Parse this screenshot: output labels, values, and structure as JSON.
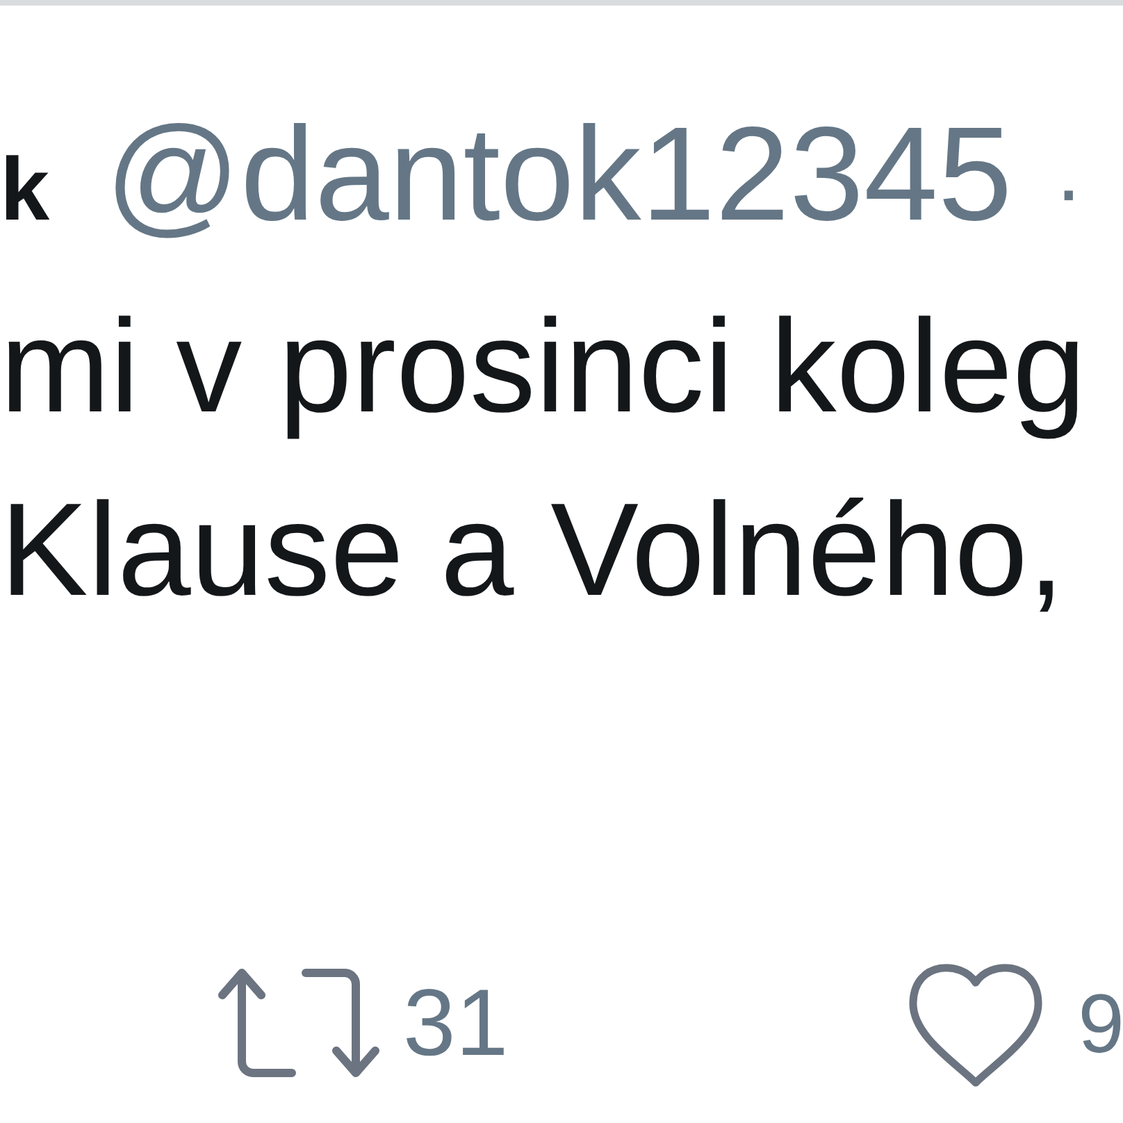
{
  "tweet": {
    "name": "k",
    "handle": "@dantok12345",
    "separator": "·",
    "text_lines": [
      "mi v prosinci koleg",
      "Klause a Volného,"
    ],
    "actions": [
      {
        "kind": "retweet",
        "count": "31"
      },
      {
        "kind": "like",
        "count": "9"
      }
    ]
  }
}
